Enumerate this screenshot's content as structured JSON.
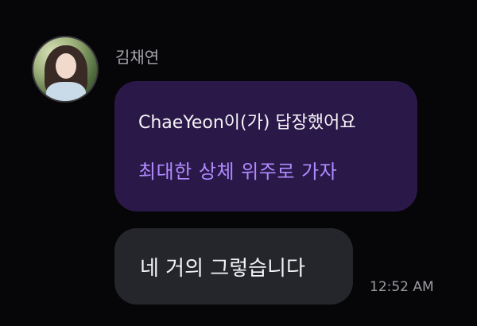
{
  "sender": {
    "name": "김채연",
    "avatar_icon": "profile-photo"
  },
  "reply": {
    "header": "ChaeYeon이(가) 답장했어요",
    "quoted_text": "최대한 상체 위주로 가자"
  },
  "message": {
    "text": "네 거의 그렇습니다",
    "timestamp": "12:52 AM"
  },
  "colors": {
    "background": "#060508",
    "reply_bubble": "#2a1848",
    "reply_quote_text": "#b08aff",
    "message_bubble": "#25262b",
    "timestamp": "#9a9aa0"
  }
}
